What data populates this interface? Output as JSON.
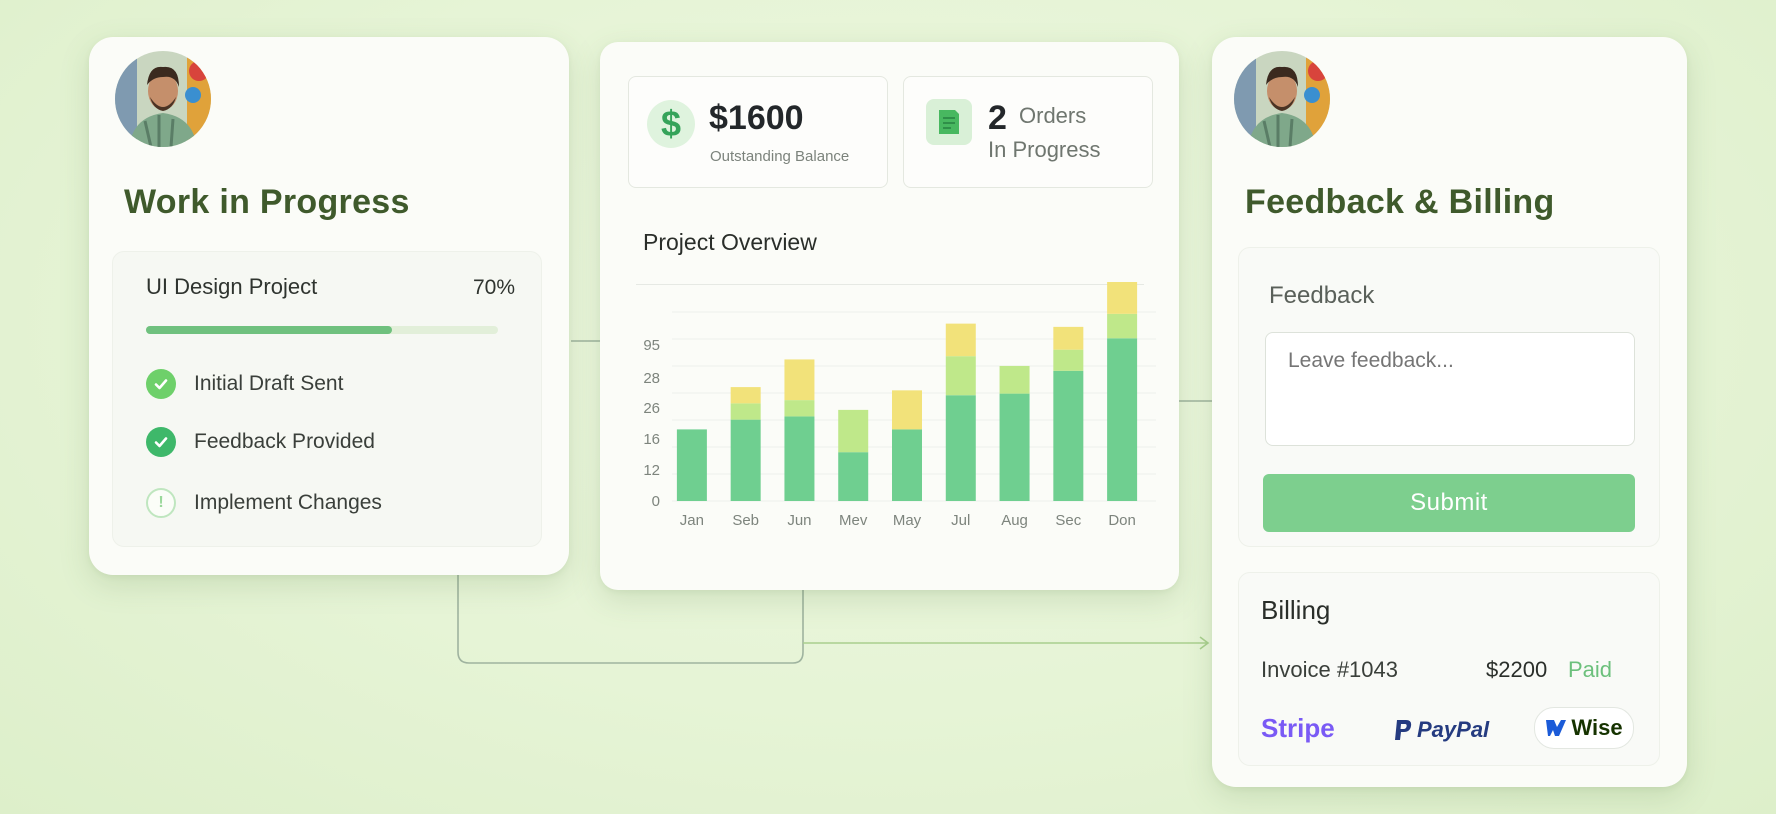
{
  "wip": {
    "title": "Work in Progress",
    "project": {
      "name": "UI Design Project",
      "percent_label": "70%",
      "progress": 0.7
    },
    "tasks": [
      {
        "label": "Initial Draft Sent",
        "status": "done"
      },
      {
        "label": "Feedback Provided",
        "status": "done"
      },
      {
        "label": "Implement Changes",
        "status": "pending"
      }
    ]
  },
  "stats": {
    "balance": {
      "value": "$1600",
      "caption": "Outstanding Balance",
      "icon": "dollar-icon"
    },
    "orders": {
      "count": "2",
      "line1": "Orders",
      "line2": "In Progress",
      "icon": "document-icon"
    }
  },
  "chart_data": {
    "type": "bar",
    "title": "Project Overview",
    "categories": [
      "Jan",
      "Seb",
      "Jun",
      "Mev",
      "May",
      "Jul",
      "Aug",
      "Sec",
      "Don"
    ],
    "y_tick_labels": [
      "0",
      "12",
      "16",
      "26",
      "28",
      "95"
    ],
    "ylim": [
      0,
      95
    ],
    "grid": true,
    "series": [
      {
        "values": [
          44,
          50,
          52,
          30,
          44,
          65,
          66,
          80,
          100
        ],
        "color": "#6fcf90"
      },
      {
        "values": [
          0,
          10,
          10,
          26,
          0,
          24,
          17,
          13,
          15
        ],
        "color": "#bfe88a"
      },
      {
        "values": [
          0,
          10,
          25,
          0,
          24,
          20,
          0,
          14,
          40
        ],
        "color": "#f2e27a"
      }
    ]
  },
  "feedback": {
    "title": "Feedback & Billing",
    "section_title": "Feedback",
    "placeholder": "Leave feedback...",
    "submit_label": "Submit"
  },
  "billing": {
    "title": "Billing",
    "invoice": "Invoice #1043",
    "amount": "$2200",
    "status": "Paid",
    "providers": [
      "Stripe",
      "PayPal",
      "Wise"
    ]
  },
  "colors": {
    "accent": "#7dcf8e",
    "title": "#3f5a2c",
    "paid": "#6cc07c",
    "stripe": "#7a5af5",
    "paypal": "#253b80"
  }
}
